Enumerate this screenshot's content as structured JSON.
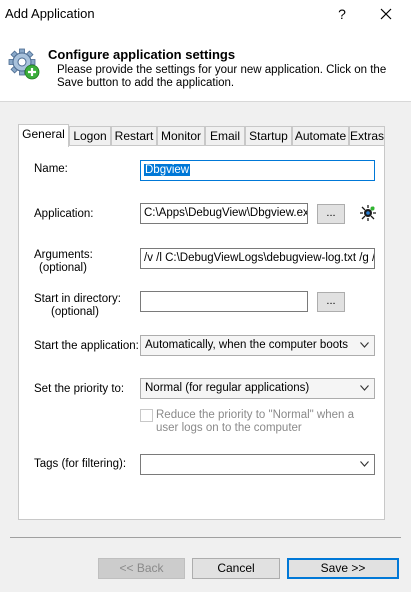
{
  "window": {
    "title": "Add Application",
    "help_glyph": "?"
  },
  "header": {
    "title": "Configure application settings",
    "description": "Please provide the settings for your new application. Click on the Save button to add the application.",
    "icon": "gear-add-icon"
  },
  "tabs": [
    {
      "label": "General",
      "active": true
    },
    {
      "label": "Logon"
    },
    {
      "label": "Restart"
    },
    {
      "label": "Monitor"
    },
    {
      "label": "Email"
    },
    {
      "label": "Startup"
    },
    {
      "label": "Automate"
    },
    {
      "label": "Extras"
    }
  ],
  "form": {
    "name_label": "Name:",
    "name_value": "Dbgview",
    "application_label": "Application:",
    "application_value": "C:\\Apps\\DebugView\\Dbgview.exe",
    "browse_label": "...",
    "arguments_label": "Arguments:",
    "arguments_sub": "(optional)",
    "arguments_value": "/v /l C:\\DebugViewLogs\\debugview-log.txt /g /t",
    "startdir_label": "Start in directory:",
    "startdir_sub": "(optional)",
    "startdir_value": "",
    "start_app_label": "Start the application:",
    "start_app_value": "Automatically, when the computer boots",
    "priority_label": "Set the priority to:",
    "priority_value": "Normal (for regular applications)",
    "reduce_priority_text": "Reduce the priority to \"Normal\" when a user logs on to the computer",
    "reduce_priority_checked": false,
    "tags_label": "Tags (for filtering):",
    "tags_value": ""
  },
  "buttons": {
    "back": "<< Back",
    "cancel": "Cancel",
    "save": "Save >>"
  },
  "colors": {
    "accent": "#0078d7",
    "panel": "#ffffff",
    "background": "#f0f0f0"
  }
}
